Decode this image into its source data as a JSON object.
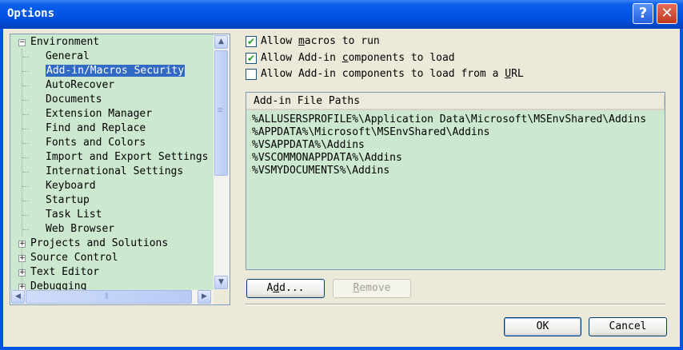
{
  "window": {
    "title": "Options",
    "help_glyph": "?",
    "close_glyph": "✕"
  },
  "tree": {
    "root": {
      "label": "Environment",
      "expander": "−"
    },
    "children": [
      "General",
      "Add-in/Macros Security",
      "AutoRecover",
      "Documents",
      "Extension Manager",
      "Find and Replace",
      "Fonts and Colors",
      "Import and Export Settings",
      "International Settings",
      "Keyboard",
      "Startup",
      "Task List",
      "Web Browser"
    ],
    "selected": "Add-in/Macros Security",
    "collapsed": [
      {
        "label": "Projects and Solutions",
        "expander": "+"
      },
      {
        "label": "Source Control",
        "expander": "+"
      },
      {
        "label": "Text Editor",
        "expander": "+"
      },
      {
        "label": "Debugging",
        "expander": "+"
      }
    ]
  },
  "scrollbar": {
    "up_arrow": "▲",
    "down_arrow": "▼",
    "left_arrow": "◀",
    "right_arrow": "▶",
    "grip": "≡",
    "hgrip": "⦀"
  },
  "options": {
    "allow_macros": {
      "pre": "Allow ",
      "accel": "m",
      "post": "acros to run",
      "checked": true
    },
    "allow_addins": {
      "pre": "Allow Add-in ",
      "accel": "c",
      "post": "omponents to load",
      "checked": true
    },
    "allow_addins_url": {
      "pre": "Allow Add-in components to load from a ",
      "accel": "U",
      "post": "RL",
      "checked": false
    },
    "check_glyph": "✔"
  },
  "paths": {
    "header": "Add-in File Paths",
    "rows": [
      "%ALLUSERSPROFILE%\\Application Data\\Microsoft\\MSEnvShared\\Addins",
      "%APPDATA%\\Microsoft\\MSEnvShared\\Addins",
      "%VSAPPDATA%\\Addins",
      "%VSCOMMONAPPDATA%\\Addins",
      "%VSMYDOCUMENTS%\\Addins"
    ]
  },
  "buttons": {
    "add": {
      "accel": "d",
      "pre": "A",
      "post": "d..."
    },
    "remove": {
      "accel": "R",
      "pre": "",
      "post": "emove"
    },
    "ok": "OK",
    "cancel": "Cancel"
  }
}
